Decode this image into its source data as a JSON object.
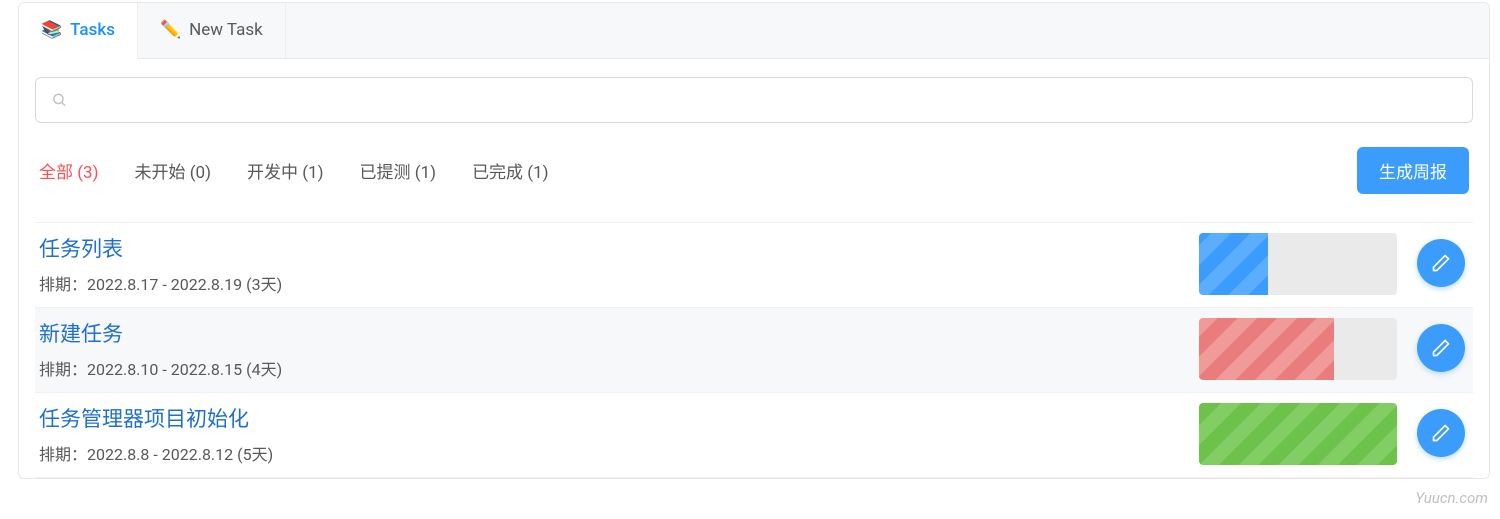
{
  "tabs": {
    "tasks": {
      "icon": "📚",
      "label": "Tasks"
    },
    "newTask": {
      "icon": "✏️",
      "label": "New Task"
    }
  },
  "search": {
    "placeholder": ""
  },
  "filters": [
    {
      "label": "全部 (3)",
      "active": true
    },
    {
      "label": "未开始 (0)",
      "active": false
    },
    {
      "label": "开发中 (1)",
      "active": false
    },
    {
      "label": "已提测 (1)",
      "active": false
    },
    {
      "label": "已完成 (1)",
      "active": false
    }
  ],
  "reportButton": "生成周报",
  "tasks": [
    {
      "title": "任务列表",
      "schedule": "排期：2022.8.17 - 2022.8.19 (3天)",
      "progress": 35,
      "color": "blue",
      "hovered": false
    },
    {
      "title": "新建任务",
      "schedule": "排期：2022.8.10 - 2022.8.15 (4天)",
      "progress": 68,
      "color": "red",
      "hovered": true
    },
    {
      "title": "任务管理器项目初始化",
      "schedule": "排期：2022.8.8 - 2022.8.12 (5天)",
      "progress": 100,
      "color": "green",
      "hovered": false
    }
  ],
  "watermark": "Yuucn.com"
}
